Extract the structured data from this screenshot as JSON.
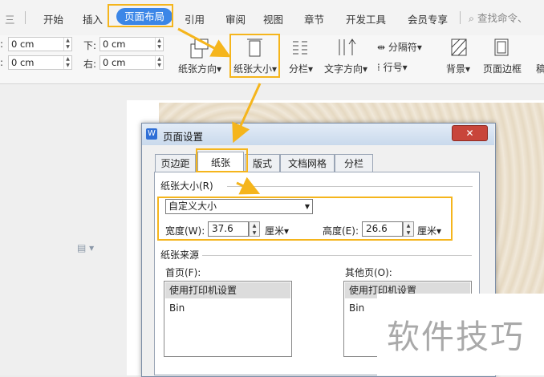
{
  "menu": {
    "items": [
      "开始",
      "插入",
      "页面布局",
      "引用",
      "审阅",
      "视图",
      "章节",
      "开发工具",
      "会员专享"
    ],
    "active": "页面布局",
    "search_placeholder": "查找命令、"
  },
  "ribbon": {
    "margins": {
      "top_value": "0 cm",
      "bottom_label": "下:",
      "bottom_value": "0 cm",
      "left_value": "0 cm",
      "right_label": "右:",
      "right_value": "0 cm"
    },
    "orientation_label": "纸张方向",
    "size_label": "纸张大小",
    "columns_label": "分栏",
    "text_direction_label": "文字方向",
    "separator_label": "分隔符",
    "line_number_label": "行号",
    "background_label": "背景",
    "page_border_label": "页面边框",
    "cut_label": "稿"
  },
  "dialog": {
    "title": "页面设置",
    "close": "✕",
    "tabs": [
      "页边距",
      "纸张",
      "版式",
      "文档网格",
      "分栏"
    ],
    "active_tab": "纸张",
    "paper_size_group": "纸张大小(R)",
    "paper_size_value": "自定义大小",
    "width_label": "宽度(W):",
    "width_value": "37.6",
    "height_label": "高度(E):",
    "height_value": "26.6",
    "unit": "厘米▾",
    "source_group": "纸张来源",
    "first_page_label": "首页(F):",
    "other_pages_label": "其他页(O):",
    "first_page_options": [
      "使用打印机设置",
      "Bin"
    ],
    "other_pages_options": [
      "使用打印机设置",
      "Bin"
    ]
  },
  "watermark": "软件技巧",
  "colors": {
    "accent": "#3b86e7",
    "highlight": "#f5b51c",
    "arrow": "#f5b51c"
  }
}
